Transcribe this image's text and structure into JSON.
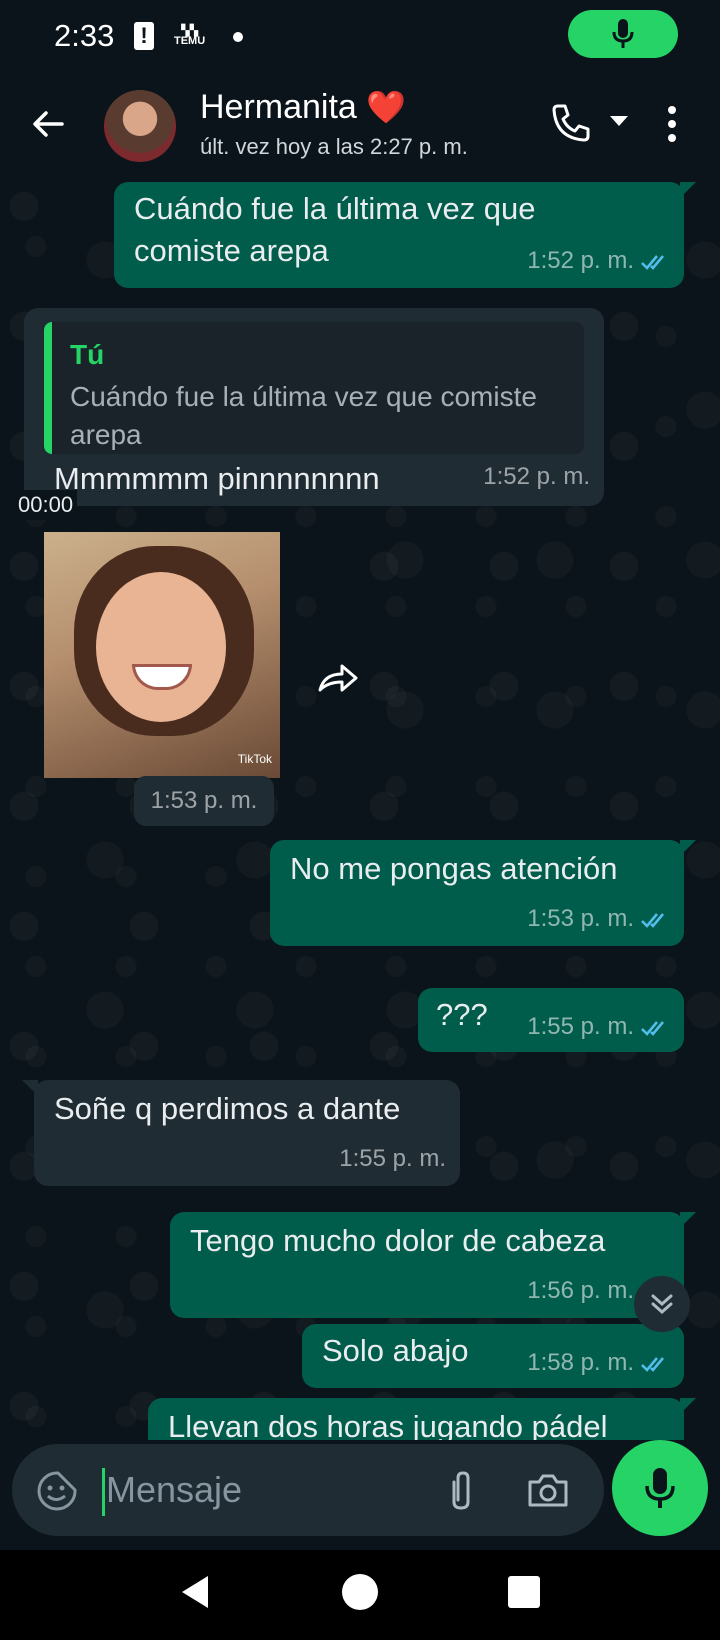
{
  "status_bar": {
    "time": "2:33",
    "alert_glyph": "!",
    "notif_label": "TEMU",
    "mic_indicator_icon": "mic-icon",
    "accent": "#25d366"
  },
  "header": {
    "back_icon": "arrow-left-icon",
    "contact_name": "Hermanita",
    "contact_emoji": "❤️",
    "last_seen": "últ. vez hoy a las 2:27 p. m.",
    "call_icon": "phone-icon",
    "menu_icon": "more-vert-icon"
  },
  "messages": [
    {
      "dir": "out",
      "text": "Cuándo fue la última vez que comiste arepa",
      "time": "1:52 p. m.",
      "status": "read"
    },
    {
      "dir": "in",
      "reply_author": "Tú",
      "reply_text": "Cuándo fue la última vez que comiste arepa",
      "text": "Mmmmmm pinnnnnnnn",
      "time": "1:52 p. m."
    },
    {
      "dir": "in",
      "type": "video",
      "duration": "00:00",
      "watermark": "TikTok",
      "time": "1:53 p. m."
    },
    {
      "dir": "out",
      "text": "No me pongas atención",
      "time": "1:53 p. m.",
      "status": "read"
    },
    {
      "dir": "out",
      "text": "???",
      "time": "1:55 p. m.",
      "status": "read"
    },
    {
      "dir": "in",
      "text": "Soñe q perdimos a dante",
      "time": "1:55 p. m."
    },
    {
      "dir": "out",
      "text": "Tengo mucho dolor de cabeza",
      "time": "1:56 p. m.",
      "status": "read"
    },
    {
      "dir": "out",
      "text": "Solo abajo",
      "time": "1:58 p. m.",
      "status": "read"
    },
    {
      "dir": "out",
      "text": "Llevan dos horas jugando pádel",
      "partial": true
    }
  ],
  "composer": {
    "placeholder": "Mensaje",
    "emoji_icon": "sticker-icon",
    "attach_icon": "paperclip-icon",
    "camera_icon": "camera-icon",
    "mic_icon": "mic-icon"
  },
  "colors": {
    "background": "#0b141a",
    "outgoing_bubble": "#005c4b",
    "incoming_bubble": "#202c33",
    "read_ticks": "#53bdeb",
    "accent": "#25d366"
  }
}
